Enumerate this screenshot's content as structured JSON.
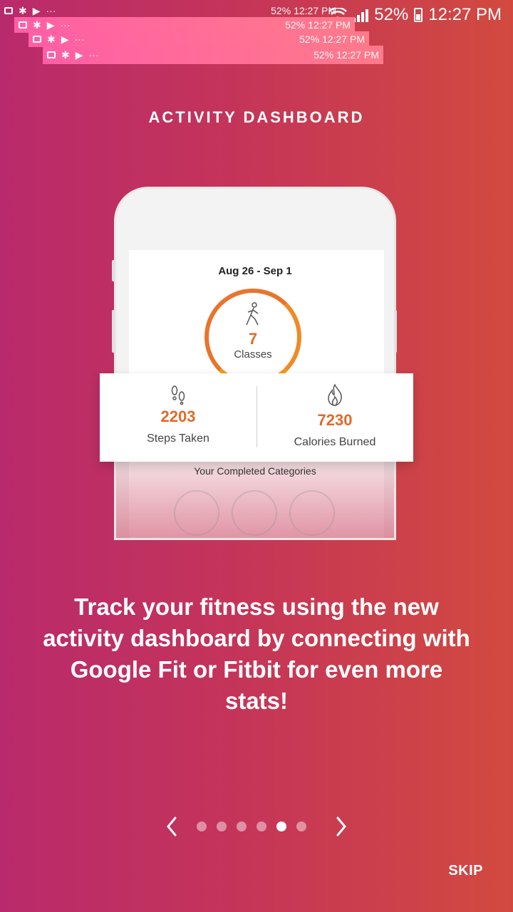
{
  "status_bar": {
    "battery": "52%",
    "time": "12:27 PM"
  },
  "notification_ghosts": [
    {
      "battery": "52%",
      "time": "12:27 PM"
    },
    {
      "battery": "52%",
      "time": "12:27 PM"
    },
    {
      "battery": "52%",
      "time": "12:27 PM"
    },
    {
      "battery": "52%",
      "time": "12:27 PM"
    }
  ],
  "title": "ACTIVITY DASHBOARD",
  "mockup": {
    "date_range": "Aug 26 - Sep 1",
    "classes": {
      "value": "7",
      "label": "Classes"
    },
    "steps": {
      "value": "2203",
      "label": "Steps Taken"
    },
    "calories": {
      "value": "7230",
      "label": "Calories Burned"
    },
    "completed_label": "Your Completed Categories",
    "accent": "#e06a28"
  },
  "body_text": "Track your fitness using the new activity dashboard by connecting with Google Fit or Fitbit for even more stats!",
  "pager": {
    "total": 6,
    "active_index": 4
  },
  "skip_label": "SKIP",
  "colors": {
    "gradient_left": "#b92a6c",
    "gradient_right": "#d24a3f"
  }
}
